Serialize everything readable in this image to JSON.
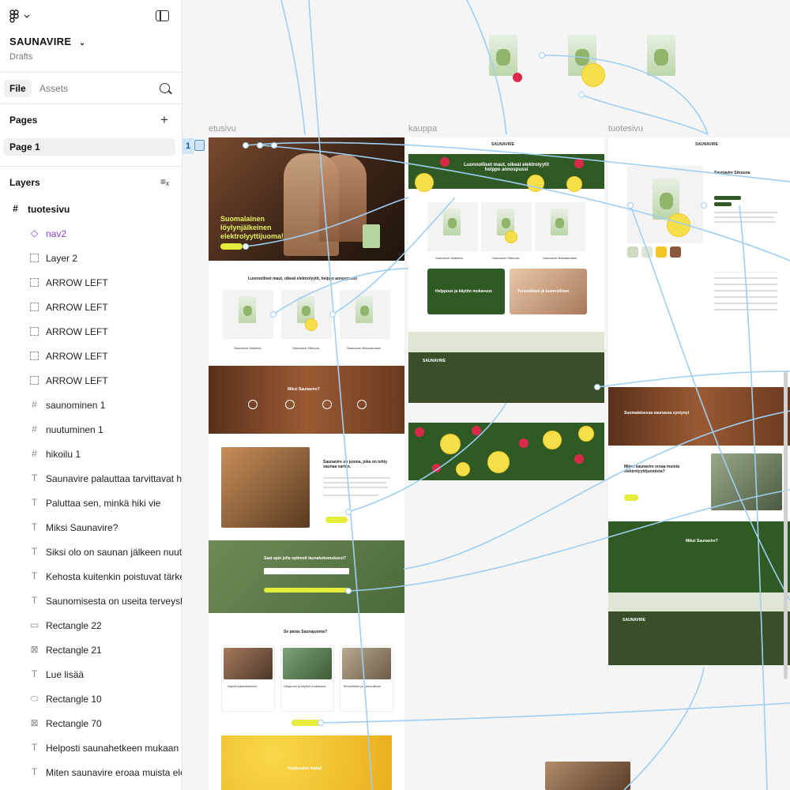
{
  "sidebar": {
    "project_name": "SAUNAVIRE",
    "project_subtitle": "Drafts",
    "tabs": [
      {
        "label": "File"
      },
      {
        "label": "Assets"
      }
    ],
    "pages_title": "Pages",
    "pages": [
      {
        "label": "Page 1"
      }
    ],
    "layers_title": "Layers",
    "layers": [
      {
        "label": "tuotesivu",
        "type": "frame"
      },
      {
        "label": "nav2",
        "type": "component"
      },
      {
        "label": "Layer 2",
        "type": "group"
      },
      {
        "label": "ARROW LEFT",
        "type": "group"
      },
      {
        "label": "ARROW LEFT",
        "type": "group"
      },
      {
        "label": "ARROW LEFT",
        "type": "group"
      },
      {
        "label": "ARROW LEFT",
        "type": "group"
      },
      {
        "label": "ARROW LEFT",
        "type": "group"
      },
      {
        "label": "saunominen 1",
        "type": "frame"
      },
      {
        "label": "nuutuminen 1",
        "type": "frame"
      },
      {
        "label": "hikoilu 1",
        "type": "frame"
      },
      {
        "label": "Saunavire palauttaa tarvittavat hiv",
        "type": "text"
      },
      {
        "label": "Paluttaa sen, minkä hiki vie",
        "type": "text"
      },
      {
        "label": "Miksi Saunavire?",
        "type": "text"
      },
      {
        "label": "Siksi olo on saunan jälkeen nuutur",
        "type": "text"
      },
      {
        "label": "Kehosta kuitenkin poistuvat tärkeä",
        "type": "text"
      },
      {
        "label": "Saunomisesta on useita terveyshy",
        "type": "text"
      },
      {
        "label": "Rectangle 22",
        "type": "rect"
      },
      {
        "label": "Rectangle 21",
        "type": "image"
      },
      {
        "label": "Lue lisää",
        "type": "text"
      },
      {
        "label": "Rectangle 10",
        "type": "rounded"
      },
      {
        "label": "Rectangle 70",
        "type": "image"
      },
      {
        "label": "Helposti saunahetkeen mukaan ot",
        "type": "text"
      },
      {
        "label": "Miten saunavire eroaa muista elek",
        "type": "text"
      }
    ]
  },
  "canvas": {
    "frames": [
      {
        "label": "etusivu"
      },
      {
        "label": "kauppa"
      },
      {
        "label": "tuotesivu"
      }
    ],
    "selection_number": "1",
    "etusivu": {
      "hero_title": "Suomalainen löylynjälkeinen elektrolyyttijuoma!",
      "section_heading": "Luonnolliset maut, oikeat elektrolyytit, helppo annospussi",
      "products": [
        "Saunavire Vadelma",
        "Saunavire Sitruuna",
        "Saunavire Maustamaton"
      ],
      "why_heading": "Miksi Saunavire?",
      "drink_heading": "Saunavire on juoma, joka on tehty saunaa varten.",
      "newsletter_heading": "Saat apin jolla optimoit taunakokemuksesi?",
      "best_heading": "Se paras Saunajuoma?",
      "cards": [
        "Nopea palautuminen",
        "Helppous ja käytön mukavuus",
        "Terveellinen ja luonnollinen"
      ],
      "flavor_heading": "Kuukauden maku!"
    },
    "kauppa": {
      "banner_text": "Luonnolliset maut, oikeat elektrolyytit helppo annospussi",
      "products": [
        "Saunavire Vadelma",
        "Saunavire Sitruuna",
        "Saunavire Maustamaton"
      ],
      "promo_left": "Helppous ja käytön mukavuus",
      "promo_right": "Terveellinen ja luonnollinen"
    },
    "tuotesivu": {
      "product_title": "Saunavire Sitruuna",
      "sauna_heading": "Suomalaisessa saunassa syntynyt",
      "diff_heading": "Miten saunavire eroaa muista elektrolyyttijuomista?",
      "why_heading": "Miksi Saunavire?"
    },
    "brand": "SAUNAVIRE"
  },
  "colors": {
    "accent_yellow": "#e6ec3c",
    "brand_green": "#3a4f29",
    "prototype_link": "#9ecff3",
    "component_purple": "#8b3fd0"
  }
}
